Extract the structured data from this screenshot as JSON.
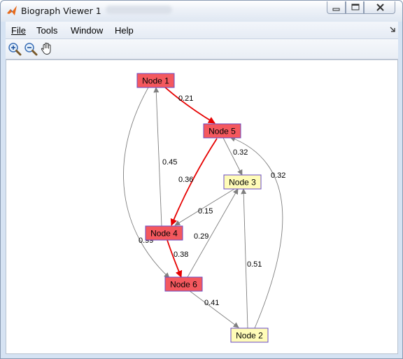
{
  "window": {
    "title": "Biograph Viewer 1"
  },
  "menu": {
    "file": "File",
    "tools": "Tools",
    "window": "Window",
    "help": "Help"
  },
  "toolbar": {
    "zoom_in": "zoom-in-icon",
    "zoom_out": "zoom-out-icon",
    "pan": "hand-icon"
  },
  "colors": {
    "highlight_node": "#f4585e",
    "normal_node": "#fffcb8",
    "node_border": "#6a4bc4",
    "highlight_edge": "#e60000",
    "normal_edge": "#7f7f7f"
  },
  "graph": {
    "nodes": {
      "node1": "Node 1",
      "node2": "Node 2",
      "node3": "Node 3",
      "node4": "Node 4",
      "node5": "Node 5",
      "node6": "Node 6"
    },
    "edge_weights": {
      "n1_n5": "0.21",
      "n5_n3": "0.32",
      "n2_n5": "0.32",
      "n4_n1": "0.45",
      "n5_n4": "0.36",
      "n3_n4": "0.15",
      "n6_n3": "0.29",
      "n1_n6": "0.99",
      "n4_n6": "0.38",
      "n2_n3": "0.51",
      "n6_n2": "0.41"
    }
  }
}
